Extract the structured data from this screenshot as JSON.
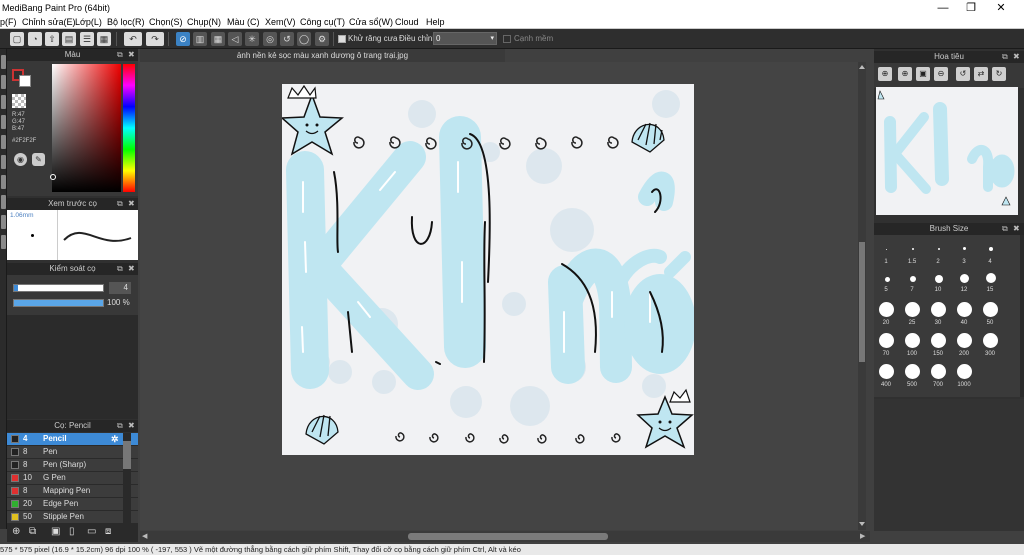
{
  "app_title": "MediBang Paint Pro (64bit)",
  "window_controls": {
    "minimize": "—",
    "maximize": "❐",
    "close": "✕"
  },
  "menu": [
    "p(F)",
    "Chỉnh sửa(E)",
    "Lớp(L)",
    "Bộ lọc(R)",
    "Chọn(S)",
    "Chụp(N)",
    "Màu (C)",
    "Xem(V)",
    "Công cụ(T)",
    "Cửa sổ(W)",
    "Cloud",
    "Help"
  ],
  "toolbar": {
    "antialias_label": "Khử răng cưa",
    "adjust_label": "Điều chỉnh",
    "adjust_value": "0",
    "edge_label": "Cạnh mềm"
  },
  "document_tab": "ảnh nền kẻ sọc màu xanh dương ô trang trại.jpg",
  "color_panel": {
    "title": "Màu",
    "r": "R:47",
    "g": "G:47",
    "b": "B:47",
    "hex": "#2F2F2F",
    "current_color": "#2f2f2f"
  },
  "brush_preview": {
    "title": "Xem trước cọ",
    "size_label": "1.06mm"
  },
  "brush_control": {
    "title": "Kiểm soát cọ",
    "size_value": "4",
    "opacity_value": "100 %"
  },
  "brush_list": {
    "title": "Cọ: Pencil",
    "items": [
      {
        "size": "4",
        "name": "Pencil",
        "color": "#222222",
        "selected": true
      },
      {
        "size": "8",
        "name": "Pen",
        "color": "#222222",
        "selected": false
      },
      {
        "size": "8",
        "name": "Pen (Sharp)",
        "color": "#222222",
        "selected": false
      },
      {
        "size": "10",
        "name": "G Pen",
        "color": "#e03030",
        "selected": false
      },
      {
        "size": "8",
        "name": "Mapping Pen",
        "color": "#e03030",
        "selected": false
      },
      {
        "size": "20",
        "name": "Edge Pen",
        "color": "#30b030",
        "selected": false
      },
      {
        "size": "50",
        "name": "Stipple Pen",
        "color": "#e0c020",
        "selected": false
      }
    ]
  },
  "navigator": {
    "title": "Hoa tiêu"
  },
  "brush_size_panel": {
    "title": "Brush Size",
    "sizes": [
      "1",
      "1.5",
      "2",
      "3",
      "4",
      "5",
      "7",
      "10",
      "12",
      "15",
      "20",
      "25",
      "30",
      "40",
      "50",
      "70",
      "100",
      "150",
      "200",
      "300",
      "400",
      "500",
      "700",
      "1000"
    ]
  },
  "artwork_text": "Khỏ",
  "colors": {
    "canvas_bg": "#f1f2f4",
    "letter_fill": "#bfe6f1",
    "dot": "#dde7ee",
    "accent_selection": "#3d8ad6"
  },
  "statusbar": {
    "text": "575 * 575 pixel  (16.9 * 15.2cm)  96 dpi  100 %  ( -197, 553 )  Vẽ một đường thẳng bằng cách giữ phím Shift, Thay đổi cỡ cọ bằng cách giữ phím Ctrl, Alt và kéo"
  }
}
